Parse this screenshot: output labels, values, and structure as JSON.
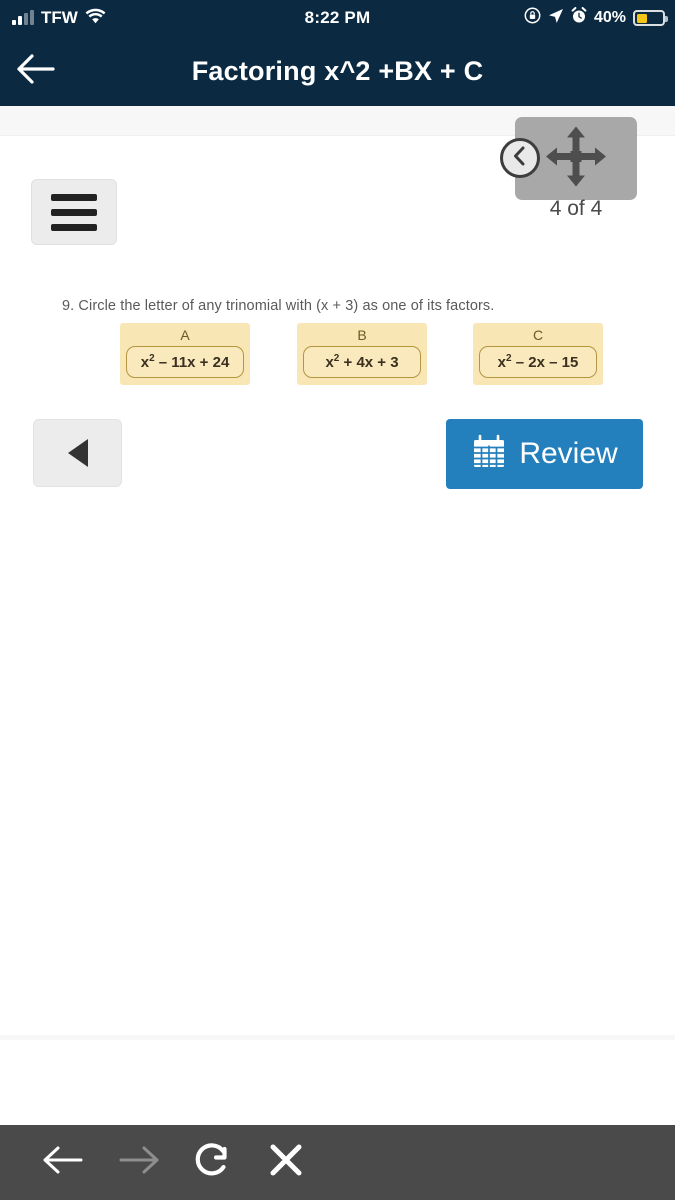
{
  "statusbar": {
    "carrier": "TFW",
    "signal_icon": "signal-bars-icon",
    "wifi_icon": "wifi-icon",
    "time": "8:22 PM",
    "rotation_lock_icon": "rotation-lock-icon",
    "location_icon": "location-arrow-icon",
    "alarm_icon": "alarm-clock-icon",
    "battery_percent": "40%",
    "battery_icon": "battery-low-power-icon",
    "battery_fill_color": "#f5c518",
    "bg_color": "#0b2a42"
  },
  "titlebar": {
    "back_icon": "back-arrow-icon",
    "title": "Factoring x^2 +BX + C",
    "bg_color": "#0b2a42"
  },
  "nav_widget": {
    "move_icon": "move-four-way-arrows-icon",
    "prev_icon": "chevron-left-circle-icon",
    "page_count": "4 of 4",
    "bg_color": "#a8a8a8"
  },
  "menu": {
    "hamburger_icon": "hamburger-menu-icon"
  },
  "worksheet": {
    "question": "9. Circle the letter of any trinomial with (x + 3) as one of its factors.",
    "options": [
      {
        "letter": "A",
        "base": "x",
        "exp": "2",
        "rest": " – 11x + 24"
      },
      {
        "letter": "B",
        "base": "x",
        "exp": "2",
        "rest": " + 4x + 3"
      },
      {
        "letter": "C",
        "base": "x",
        "exp": "2",
        "rest": " – 2x – 15"
      }
    ],
    "option_bg_color": "#f8e6b4",
    "option_border_color": "#b49640"
  },
  "controls": {
    "prev_icon": "triangle-left-icon",
    "review_icon": "calendar-grid-icon",
    "review_label": "Review",
    "review_color": "#2380bd"
  },
  "bottombar": {
    "bg_color": "#4a4a4a",
    "buttons": [
      {
        "name": "browser-back-button",
        "icon": "arrow-left-icon",
        "enabled": true
      },
      {
        "name": "browser-forward-button",
        "icon": "arrow-right-icon",
        "enabled": false
      },
      {
        "name": "browser-reload-button",
        "icon": "reload-circular-arrow-icon",
        "enabled": true
      },
      {
        "name": "browser-close-button",
        "icon": "close-x-icon",
        "enabled": true
      }
    ]
  }
}
